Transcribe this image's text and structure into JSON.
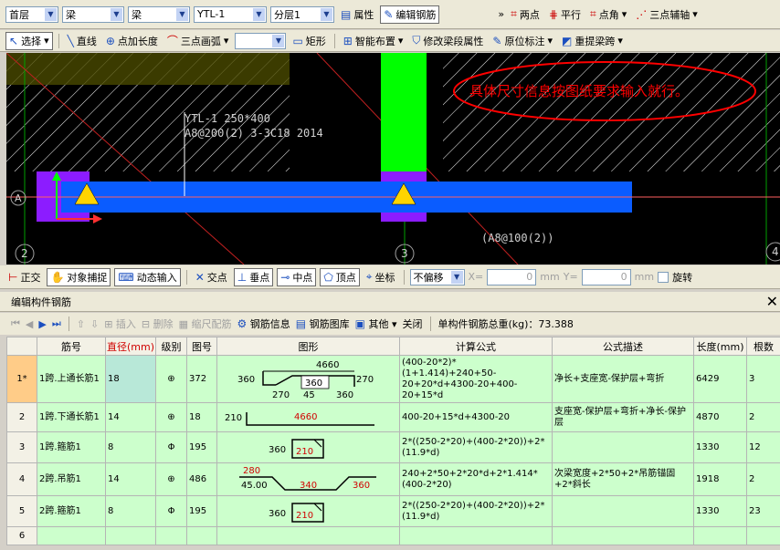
{
  "toolbar1": {
    "floor": "首层",
    "element_type": "梁",
    "element_subtype": "梁",
    "element_name": "YTL-1",
    "layer": "分层1",
    "attr_label": "属性",
    "edit_rebar_label": "编辑钢筋",
    "more": "»",
    "two_points": "两点",
    "parallel": "平行",
    "point_angle": "点角",
    "three_point_aux": "三点辅轴"
  },
  "toolbar2": {
    "select": "选择",
    "line": "直线",
    "point_length": "点加长度",
    "arc": "三点画弧",
    "rect": "矩形",
    "smart_layout": "智能布置",
    "modify_span_attr": "修改梁段属性",
    "in_place_mark": "原位标注",
    "re_extract_span": "重提梁跨"
  },
  "canvas": {
    "beam_label_line1": "YTL-1 250*400",
    "beam_label_line2": "A8@200(2) 3-3C18 2014",
    "annotation": "具体尺寸信息按图纸要求输入就行。",
    "stirrup_label": "(A8@100(2))",
    "axis_a": "A",
    "axis_2": "2",
    "axis_3": "3",
    "axis_4": "4"
  },
  "statusbar": {
    "ortho": "正交",
    "snap": "对象捕捉",
    "dynamic_input": "动态输入",
    "intersection": "交点",
    "perpendicular": "垂点",
    "midpoint": "中点",
    "vertex": "顶点",
    "coordinate": "坐标",
    "offset_mode": "不偏移",
    "x_label": "X=",
    "x_value": "0",
    "y_label": "Y=",
    "y_value": "0",
    "unit": "mm",
    "rotate": "旋转"
  },
  "panel": {
    "title": "编辑构件钢筋",
    "insert": "插入",
    "delete": "删除",
    "scale_bars": "缩尺配筋",
    "rebar_info": "钢筋信息",
    "rebar_library": "钢筋图库",
    "other": "其他",
    "close": "关闭",
    "total_weight": "单构件钢筋总重(kg)：73.388"
  },
  "table": {
    "headers": [
      "",
      "筋号",
      "直径(mm)",
      "级别",
      "图号",
      "图形",
      "计算公式",
      "公式描述",
      "长度(mm)",
      "根数"
    ],
    "rows": [
      {
        "idx": "1*",
        "name": "1跨.上通长筋1",
        "dia": "18",
        "grade": "⊕",
        "fig": "372",
        "formula": "(400-20*2)*(1+1.414)+240+50-20+20*d+4300-20+400-20+15*d",
        "desc": "净长+支座宽-保护层+弯折",
        "length": "6429",
        "count": "3",
        "shape": {
          "top": "4660",
          "left": "360",
          "right": "270",
          "mid": "360",
          "b1": "270",
          "b2": "45",
          "b3": "360"
        }
      },
      {
        "idx": "2",
        "name": "1跨.下通长筋1",
        "dia": "14",
        "grade": "⊕",
        "fig": "18",
        "formula": "400-20+15*d+4300-20",
        "desc": "支座宽-保护层+弯折+净长-保护层",
        "length": "4870",
        "count": "2",
        "shape": {
          "left": "210",
          "main": "4660"
        }
      },
      {
        "idx": "3",
        "name": "1跨.箍筋1",
        "dia": "8",
        "grade": "Φ",
        "fig": "195",
        "formula": "2*((250-2*20)+(400-2*20))+2*(11.9*d)",
        "desc": "",
        "length": "1330",
        "count": "12",
        "shape": {
          "left": "360",
          "inner": "210"
        }
      },
      {
        "idx": "4",
        "name": "2跨.吊筋1",
        "dia": "14",
        "grade": "⊕",
        "fig": "486",
        "formula": "240+2*50+2*20*d+2*1.414*(400-2*20)",
        "desc": "次梁宽度+2*50+2*吊筋锚固+2*斜长",
        "length": "1918",
        "count": "2",
        "shape": {
          "top": "280",
          "angle": "45.00",
          "mid": "340",
          "right": "360"
        }
      },
      {
        "idx": "5",
        "name": "2跨.箍筋1",
        "dia": "8",
        "grade": "Φ",
        "fig": "195",
        "formula": "2*((250-2*20)+(400-2*20))+2*(11.9*d)",
        "desc": "",
        "length": "1330",
        "count": "23",
        "shape": {
          "left": "360",
          "inner": "210"
        }
      },
      {
        "idx": "6",
        "name": "",
        "dia": "",
        "grade": "",
        "fig": "",
        "formula": "",
        "desc": "",
        "length": "",
        "count": "",
        "shape": null
      }
    ]
  },
  "colors": {
    "beam_blue": "#0a5cff",
    "column_green": "#00ff00",
    "column_purple": "#8c1cff",
    "annotation_red": "#ff0000",
    "table_green": "#ccffcc"
  }
}
